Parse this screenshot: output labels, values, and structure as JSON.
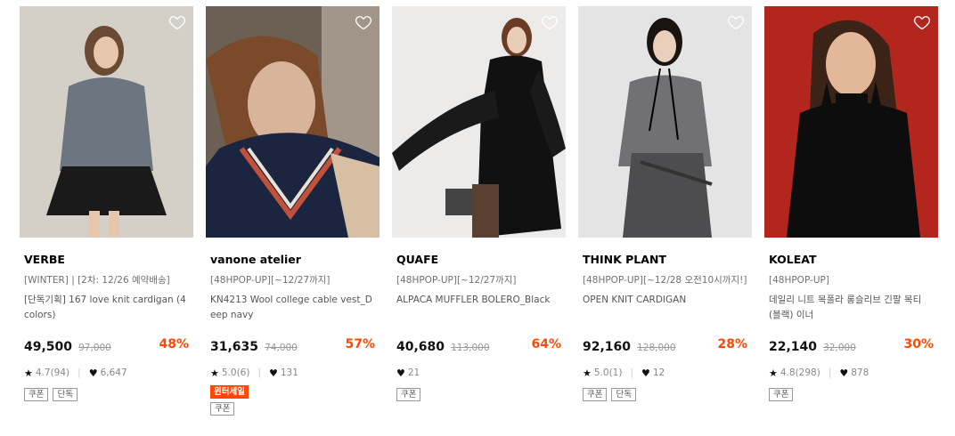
{
  "colors": {
    "accent": "#ff4800",
    "text": "#111111",
    "muted": "#888888"
  },
  "products": [
    {
      "brand": "VERBE",
      "promo": "[WINTER] | [2차: 12/26 예약배송]",
      "name": "[단독기획] 167 love knit cardigan (4 colors)",
      "price": "49,500",
      "original_price": "97,000",
      "discount": "48%",
      "rating": "4.7(94)",
      "likes": "6,647",
      "tags": [
        "쿠폰",
        "단독"
      ],
      "badge": "",
      "photo": "model in grey knit cardigan and black skirt",
      "photo_bg": "#d9d6cf"
    },
    {
      "brand": "vanone atelier",
      "promo": "[48HPOP-UP][~12/27까지]",
      "name": "KN4213 Wool college cable vest_Deep navy",
      "price": "31,635",
      "original_price": "74,000",
      "discount": "57%",
      "rating": "5.0(6)",
      "likes": "131",
      "tags": [],
      "badge": "윈터세일",
      "tags_after_badge": [
        "쿠폰"
      ],
      "photo": "model in navy cable vest",
      "photo_bg": "#6b6053"
    },
    {
      "brand": "QUAFE",
      "promo": "[48HPOP-UP][~12/27까지]",
      "name": "ALPACA MUFFLER BOLERO_Black",
      "price": "40,680",
      "original_price": "113,000",
      "discount": "64%",
      "rating": "",
      "likes": "21",
      "tags": [
        "쿠폰"
      ],
      "badge": "",
      "photo": "model in black alpaca bolero",
      "photo_bg": "#ecebe9"
    },
    {
      "brand": "THINK PLANT",
      "promo": "[48HPOP-UP][~12/28 오전10시까지!]",
      "name": "OPEN KNIT CARDIGAN",
      "price": "92,160",
      "original_price": "128,000",
      "discount": "28%",
      "rating": "5.0(1)",
      "likes": "12",
      "tags": [
        "쿠폰",
        "단독"
      ],
      "badge": "",
      "photo": "model in grey open knit cardigan",
      "photo_bg": "#e4e4e4"
    },
    {
      "brand": "KOLEAT",
      "promo": "[48HPOP-UP]",
      "name": "데일리 니트 목폴라 롱슬리브 긴팔 목티 (블랙) 이너",
      "price": "22,140",
      "original_price": "32,000",
      "discount": "30%",
      "rating": "4.8(298)",
      "likes": "878",
      "tags": [
        "쿠폰"
      ],
      "badge": "",
      "photo": "model in black turtleneck on red background",
      "photo_bg": "#b3261e"
    }
  ]
}
